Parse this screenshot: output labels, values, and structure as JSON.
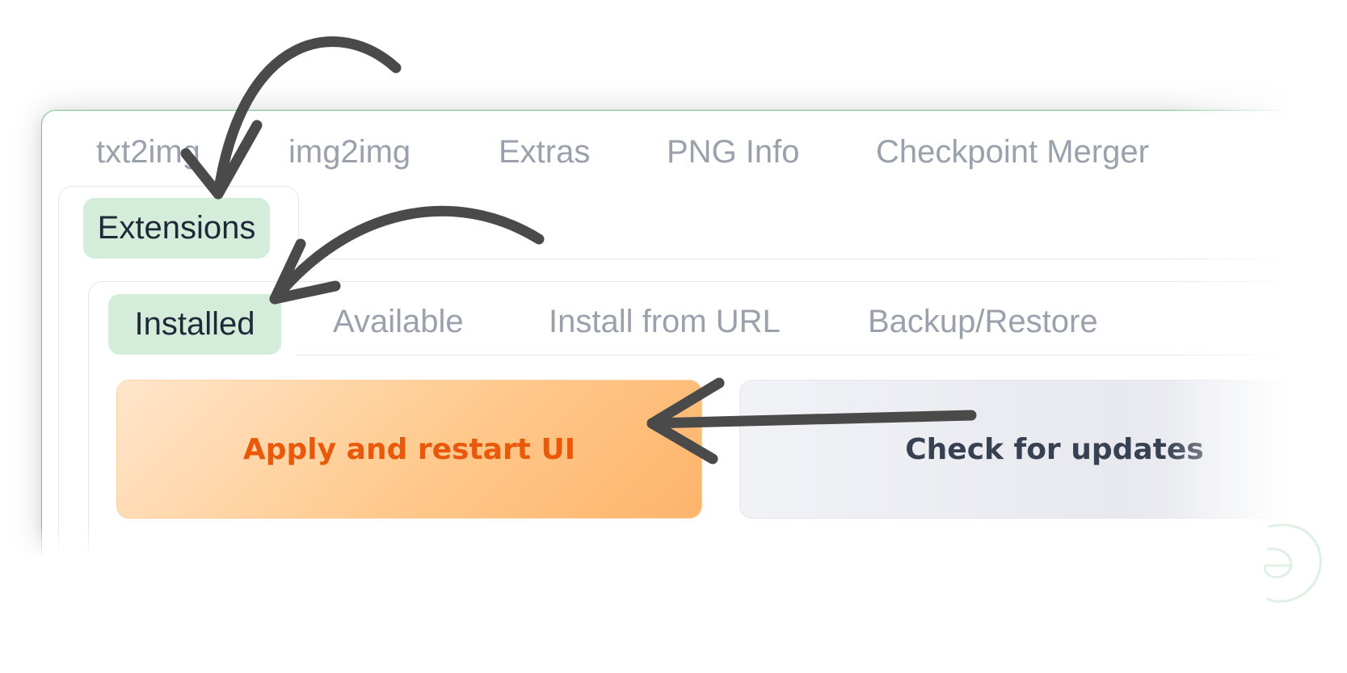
{
  "top_tabs": {
    "txt2img": "txt2img",
    "img2img": "img2img",
    "extras": "Extras",
    "png_info": "PNG Info",
    "checkpoint_merger": "Checkpoint Merger",
    "extensions": "Extensions"
  },
  "extension_tabs": {
    "installed": "Installed",
    "available": "Available",
    "install_from_url": "Install from URL",
    "backup_restore": "Backup/Restore"
  },
  "buttons": {
    "apply_restart": "Apply and restart UI",
    "check_updates": "Check for updates"
  },
  "colors": {
    "active_tab_bg": "#d3edda",
    "apply_button_text": "#ea580c",
    "apply_button_bg": "#ffc98c",
    "check_button_bg": "#e8e9ef",
    "panel_border": "#6cc58a",
    "arrow": "#4a4a4a"
  },
  "icons": {
    "logo": "watermark-logo-icon",
    "annotation_arrows": "curved-arrow-icon"
  }
}
